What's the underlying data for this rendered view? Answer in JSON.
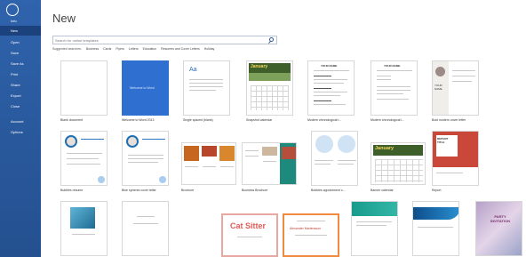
{
  "nav": [
    {
      "label": "Info"
    },
    {
      "label": "New",
      "active": true
    },
    {
      "label": "Open"
    },
    {
      "label": "Save"
    },
    {
      "label": "Save As"
    },
    {
      "label": "Print"
    },
    {
      "label": "Share"
    },
    {
      "label": "Export"
    },
    {
      "label": "Close"
    },
    {
      "label": "Account"
    },
    {
      "label": "Options"
    }
  ],
  "header": {
    "title": "New"
  },
  "search": {
    "placeholder": "Search for online templates"
  },
  "suggested": {
    "label": "Suggested searches:",
    "items": [
      "Business",
      "Cards",
      "Flyers",
      "Letters",
      "Education",
      "Resumes and Cover Letters",
      "Holiday"
    ]
  },
  "templates": [
    {
      "caption": "Blank document"
    },
    {
      "caption": "Welcome to Word 2013",
      "thumb_text": "Welcome to Word"
    },
    {
      "caption": "Single spaced (blank)",
      "thumb_text": "Aa"
    },
    {
      "caption": "Snapshot calendar",
      "thumb_text": "January"
    },
    {
      "caption": "Modern chronological r...",
      "thumb_text": "YOUR NAME"
    },
    {
      "caption": "Modern chronological l...",
      "thumb_text": "YOUR NAME"
    },
    {
      "caption": "Bold modern cover letter",
      "thumb_text": "YOUR NAME"
    },
    {
      "caption": "Bubbles resume"
    },
    {
      "caption": "Blue spheres cover letter"
    },
    {
      "caption": "Brochure"
    },
    {
      "caption": "Business Brochure"
    },
    {
      "caption": "Bubbles appointment c..."
    },
    {
      "caption": "Banner calendar",
      "thumb_text": "January"
    },
    {
      "caption": "Report",
      "thumb_text": "REPORT TITLE"
    },
    {
      "caption": ""
    },
    {
      "caption": ""
    },
    {
      "caption": "",
      "thumb_text": "Cat Sitter"
    },
    {
      "caption": "",
      "thumb_text": "Alexander Martensson"
    },
    {
      "caption": ""
    },
    {
      "caption": ""
    },
    {
      "caption": "",
      "thumb_text": "PARTY INVITATION"
    }
  ]
}
